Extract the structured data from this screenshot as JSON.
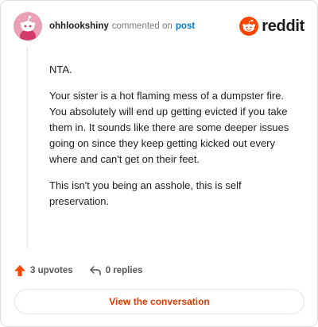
{
  "header": {
    "username": "ohhlookshiny",
    "action_text": "commented on",
    "post_link": "post",
    "brand": "reddit"
  },
  "comment": {
    "paragraphs": [
      "NTA.",
      "Your sister is a hot flaming mess of a dumpster fire. You absolutely will end up getting evicted if you take them in. It sounds like there are some deeper issues going on since they keep getting kicked out every where and can't get on their feet.",
      "This isn't you being an asshole, this is self preservation."
    ]
  },
  "footer": {
    "upvotes": "3 upvotes",
    "replies": "0 replies"
  },
  "cta": {
    "label": "View the conversation"
  },
  "colors": {
    "brand_orange": "#ff4500",
    "link_blue": "#0079d3",
    "cta_text": "#d93a00",
    "avatar_bg": "#e8a0b4"
  },
  "icons": [
    "avatar-snoo-icon",
    "reddit-logo-icon",
    "upvote-arrow-icon",
    "reply-arrow-icon"
  ]
}
